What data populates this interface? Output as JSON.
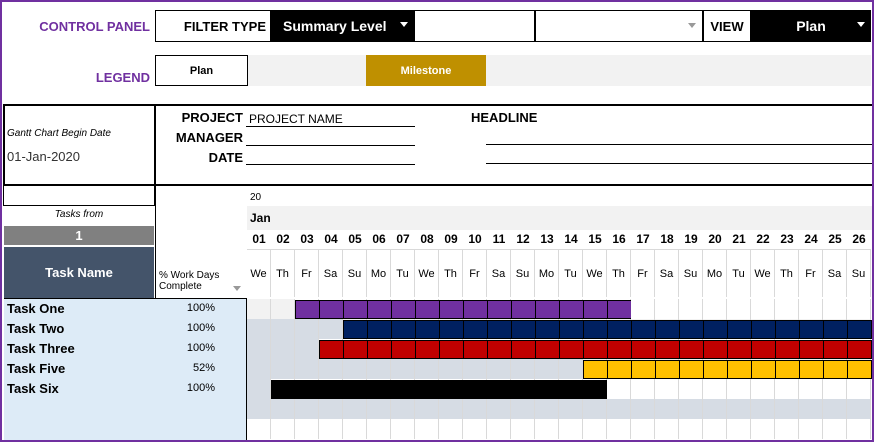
{
  "control_panel": {
    "label": "CONTROL PANEL",
    "filter_type_label": "FILTER TYPE",
    "filter_type_value": "Summary Level",
    "filter_value": "",
    "view_label": "VIEW",
    "view_value": "Plan"
  },
  "legend": {
    "label": "LEGEND",
    "plan": "Plan",
    "milestone": "Milestone"
  },
  "header": {
    "begin_date_label": "Gantt Chart Begin Date",
    "begin_date_value": "01-Jan-2020",
    "project_label": "PROJECT",
    "project_value": "PROJECT NAME",
    "manager_label": "MANAGER",
    "manager_value": "",
    "date_label": "DATE",
    "date_value": "",
    "headline_label": "HEADLINE"
  },
  "tasks_from": {
    "label": "Tasks from",
    "value": "1"
  },
  "columns": {
    "task_name": "Task Name",
    "work_days": "% Work Days Complete"
  },
  "timeline": {
    "year": "20",
    "month": "Jan",
    "days": [
      {
        "num": "01",
        "dow": "We"
      },
      {
        "num": "02",
        "dow": "Th"
      },
      {
        "num": "03",
        "dow": "Fr"
      },
      {
        "num": "04",
        "dow": "Sa"
      },
      {
        "num": "05",
        "dow": "Su"
      },
      {
        "num": "06",
        "dow": "Mo"
      },
      {
        "num": "07",
        "dow": "Tu"
      },
      {
        "num": "08",
        "dow": "We"
      },
      {
        "num": "09",
        "dow": "Th"
      },
      {
        "num": "10",
        "dow": "Fr"
      },
      {
        "num": "11",
        "dow": "Sa"
      },
      {
        "num": "12",
        "dow": "Su"
      },
      {
        "num": "13",
        "dow": "Mo"
      },
      {
        "num": "14",
        "dow": "Tu"
      },
      {
        "num": "15",
        "dow": "We"
      },
      {
        "num": "16",
        "dow": "Th"
      },
      {
        "num": "17",
        "dow": "Fr"
      },
      {
        "num": "18",
        "dow": "Sa"
      },
      {
        "num": "19",
        "dow": "Su"
      },
      {
        "num": "20",
        "dow": "Mo"
      },
      {
        "num": "21",
        "dow": "Tu"
      },
      {
        "num": "22",
        "dow": "We"
      },
      {
        "num": "23",
        "dow": "Th"
      },
      {
        "num": "24",
        "dow": "Fr"
      },
      {
        "num": "25",
        "dow": "Sa"
      },
      {
        "num": "26",
        "dow": "Su"
      }
    ]
  },
  "tasks": [
    {
      "name": "Task One",
      "pct": "100%",
      "color": "#7030a0",
      "start": 3,
      "end": 16
    },
    {
      "name": "Task Two",
      "pct": "100%",
      "color": "#002060",
      "start": 5,
      "end": 26
    },
    {
      "name": "Task Three",
      "pct": "100%",
      "color": "#c00000",
      "start": 4,
      "end": 26
    },
    {
      "name": "Task Five",
      "pct": "52%",
      "color": "#ffc000",
      "start": 15,
      "end": 26
    },
    {
      "name": "Task Six",
      "pct": "100%",
      "color": "#000000",
      "start": 2,
      "end": 15
    }
  ],
  "colors": {
    "accent": "#7030a0",
    "milestone": "#bf9000",
    "task_header_bg": "#44546a",
    "task_list_bg": "#ddebf7",
    "tasks_from_bg": "#808080",
    "weekend_bg": "#f2f2f2",
    "pre_start_bg": "#d6dce4"
  }
}
